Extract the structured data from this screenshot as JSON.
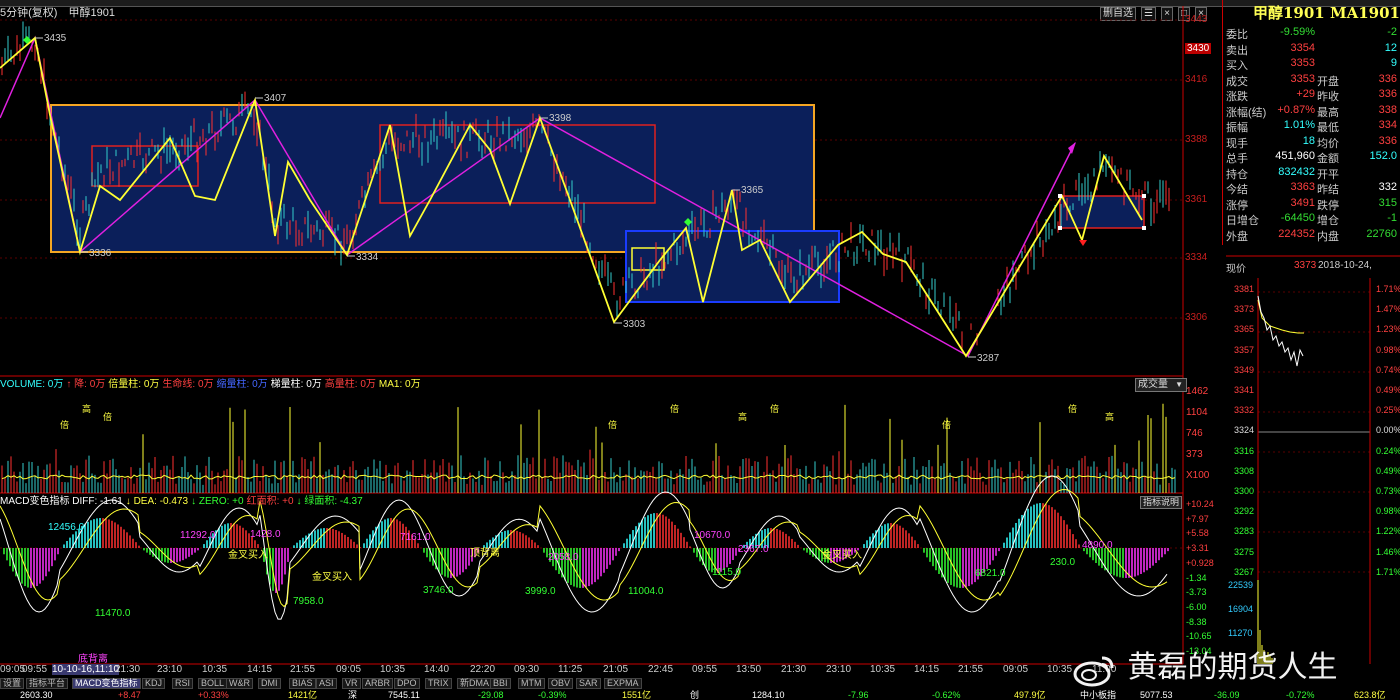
{
  "header": {
    "period": "5分钟(复权)",
    "symbol": "甲醇1901"
  },
  "top_right_buttons": [
    "删自选",
    "☰",
    "×",
    "□",
    "×"
  ],
  "price_axis": {
    "ticks": [
      3443,
      3430,
      3416,
      3388,
      3361,
      3334,
      3306
    ],
    "highlight": 3430
  },
  "chart_annotations": [
    "3435",
    "3407",
    "3398",
    "3336",
    "3334",
    "3365",
    "3303",
    "3287"
  ],
  "quote": {
    "title": "甲醇1901 MA1901",
    "rows": [
      {
        "l": "委比",
        "v": "-9.59%",
        "vc": "green",
        "l2": "",
        "v2": "-2",
        "v2c": "green"
      },
      {
        "l": "卖出",
        "v": "3354",
        "vc": "red",
        "l2": "",
        "v2": "12",
        "v2c": "cyan"
      },
      {
        "l": "买入",
        "v": "3353",
        "vc": "red",
        "l2": "",
        "v2": "9",
        "v2c": "cyan"
      },
      {
        "l": "成交",
        "v": "3353",
        "vc": "red",
        "l2": "开盘",
        "v2": "336",
        "v2c": "red"
      },
      {
        "l": "涨跌",
        "v": "+29",
        "vc": "red",
        "l2": "昨收",
        "v2": "336",
        "v2c": "red"
      },
      {
        "l": "涨幅(结)",
        "v": "+0.87%",
        "vc": "red",
        "l2": "最高",
        "v2": "338",
        "v2c": "red"
      },
      {
        "l": "振幅",
        "v": "1.01%",
        "vc": "cyan",
        "l2": "最低",
        "v2": "334",
        "v2c": "red"
      },
      {
        "l": "现手",
        "v": "18",
        "vc": "cyan",
        "l2": "均价",
        "v2": "336",
        "v2c": "red"
      },
      {
        "l": "总手",
        "v": "451,960",
        "vc": "white",
        "l2": "金额",
        "v2": "152.0",
        "v2c": "cyan"
      },
      {
        "l": "持仓",
        "v": "832432",
        "vc": "cyan",
        "l2": "开平",
        "v2": "",
        "v2c": "white"
      },
      {
        "l": "今结",
        "v": "3363",
        "vc": "red",
        "l2": "昨结",
        "v2": "332",
        "v2c": "white"
      },
      {
        "l": "涨停",
        "v": "3491",
        "vc": "red",
        "l2": "跌停",
        "v2": "315",
        "v2c": "green"
      },
      {
        "l": "日增仓",
        "v": "-64450",
        "vc": "green",
        "l2": "增仓",
        "v2": "-1",
        "v2c": "green"
      },
      {
        "l": "外盘",
        "v": "224352",
        "vc": "red",
        "l2": "内盘",
        "v2": "22760",
        "v2c": "green"
      }
    ]
  },
  "mini_chart": {
    "label_price": "现价",
    "price": "3373",
    "date": "2018-10-24,",
    "left_ticks": [
      "3381",
      "3373",
      "3365",
      "3357",
      "3349",
      "3341",
      "3332",
      "3324",
      "3316",
      "3308",
      "3300",
      "3292",
      "3283",
      "3275",
      "3267"
    ],
    "right_ticks": [
      "1.71%",
      "1.47%",
      "1.23%",
      "0.98%",
      "0.74%",
      "0.49%",
      "0.25%",
      "0.00%",
      "0.24%",
      "0.49%",
      "0.73%",
      "0.98%",
      "1.22%",
      "1.46%",
      "1.71%"
    ],
    "vol_ticks": [
      "22539",
      "16904",
      "11270"
    ]
  },
  "volume_panel": {
    "header": [
      {
        "t": "VOLUME: 0万",
        "c": "#33ffff"
      },
      {
        "t": "↑ 降: 0万",
        "c": "#ff4040"
      },
      {
        "t": "倍量柱: 0万",
        "c": "#ffff44"
      },
      {
        "t": "生命线: 0万",
        "c": "#ff4040"
      },
      {
        "t": "缩量柱: 0万",
        "c": "#4466ff"
      },
      {
        "t": "梯量柱: 0万",
        "c": "#ffffff"
      },
      {
        "t": "高量柱: 0万",
        "c": "#ff4040"
      },
      {
        "t": "MA1: 0万",
        "c": "#ffff44"
      }
    ],
    "select": "成交量",
    "ticks": [
      "1462",
      "1104",
      "746",
      "373",
      "X100"
    ],
    "marks": [
      "高",
      "倍",
      "倍",
      "倍",
      "高",
      "倍",
      "倍",
      "高",
      "倍",
      "倍"
    ]
  },
  "macd_panel": {
    "header": [
      {
        "t": "MACD变色指标 DIFF: -1.61",
        "c": "#ffffff"
      },
      {
        "t": "↓ DEA: -0.473",
        "c": "#ffff44"
      },
      {
        "t": "↓ ZERO: +0",
        "c": "#33ff33"
      },
      {
        "t": "红面积: +0",
        "c": "#ff4040"
      },
      {
        "t": "↓ 绿面积: -4.37",
        "c": "#33ff33"
      }
    ],
    "note": "指标说明",
    "ticks": [
      "+10.24",
      "+7.97",
      "+5.58",
      "+3.31",
      "+0.928",
      "-1.34",
      "-3.73",
      "-6.00",
      "-8.38",
      "-10.65",
      "-13.04"
    ],
    "labels": [
      {
        "t": "12456.0",
        "c": "#33ffff"
      },
      {
        "t": "11292.0",
        "c": "#ff44ff"
      },
      {
        "t": "1428.0",
        "c": "#ff44ff"
      },
      {
        "t": "7161.0",
        "c": "#ff44ff"
      },
      {
        "t": "2058.0",
        "c": "#ff44ff"
      },
      {
        "t": "10670.0",
        "c": "#ff44ff"
      },
      {
        "t": "2367.0",
        "c": "#ff44ff"
      },
      {
        "t": "4890.0",
        "c": "#ff44ff"
      },
      {
        "t": "11470.0",
        "c": "#33ff33"
      },
      {
        "t": "7958.0",
        "c": "#33ff33"
      },
      {
        "t": "3746.0",
        "c": "#33ff33"
      },
      {
        "t": "3999.0",
        "c": "#33ff33"
      },
      {
        "t": "11004.0",
        "c": "#33ff33"
      },
      {
        "t": "1115.0",
        "c": "#33ff33"
      },
      {
        "t": "6821.0",
        "c": "#33ff33"
      },
      {
        "t": "230.0",
        "c": "#33ff33"
      },
      {
        "t": "底背离",
        "c": "#ff44ff"
      },
      {
        "t": "顶背离",
        "c": "#ffff44"
      },
      {
        "t": "金叉买入",
        "c": "#ffff44"
      },
      {
        "t": "金叉买入",
        "c": "#ffff44"
      },
      {
        "t": "金叉买入",
        "c": "#ffff44"
      }
    ]
  },
  "time_axis": [
    "09:05",
    "09:55",
    "10-10-16,11:10",
    "21:30",
    "23:10",
    "10:35",
    "14:15",
    "21:55",
    "09:05",
    "10:35",
    "14:40",
    "22:20",
    "09:30",
    "11:25",
    "21:05",
    "22:45",
    "09:55",
    "13:50",
    "21:30",
    "23:10",
    "10:35",
    "14:15",
    "21:55",
    "09:05",
    "10:35",
    "11:00"
  ],
  "tabs": [
    "设置",
    "指标平台",
    "MACD变色指标",
    "KDJ",
    "RSI",
    "BOLL",
    "W&R",
    "DMI",
    "BIAS",
    "ASI",
    "VR",
    "ARBR",
    "DPO",
    "TRIX",
    "新DMA",
    "BBI",
    "MTM",
    "OBV",
    "SAR",
    "EXPMA"
  ],
  "status_bar": [
    {
      "t": "2603.30",
      "c": "#ffffff"
    },
    {
      "t": "+8.47",
      "c": "#ff4040"
    },
    {
      "t": "+0.33%",
      "c": "#ff4040"
    },
    {
      "t": "1421亿",
      "c": "#ffff44"
    },
    {
      "t": "深",
      "c": "#ffffff"
    },
    {
      "t": "7545.11",
      "c": "#ffffff"
    },
    {
      "t": "-29.08",
      "c": "#33ff33"
    },
    {
      "t": "-0.39%",
      "c": "#33ff33"
    },
    {
      "t": "1551亿",
      "c": "#ffff44"
    },
    {
      "t": "创",
      "c": "#ffffff"
    },
    {
      "t": "1284.10",
      "c": "#ffffff"
    },
    {
      "t": "-7.96",
      "c": "#33ff33"
    },
    {
      "t": "-0.62%",
      "c": "#33ff33"
    },
    {
      "t": "497.9亿",
      "c": "#ffff44"
    },
    {
      "t": "中小板指",
      "c": "#ffffff"
    },
    {
      "t": "5077.53",
      "c": "#ffffff"
    },
    {
      "t": "-36.09",
      "c": "#33ff33"
    },
    {
      "t": "-0.72%",
      "c": "#33ff33"
    },
    {
      "t": "623.8亿",
      "c": "#ffff44"
    }
  ],
  "watermark": "黄磊的期货人生"
}
